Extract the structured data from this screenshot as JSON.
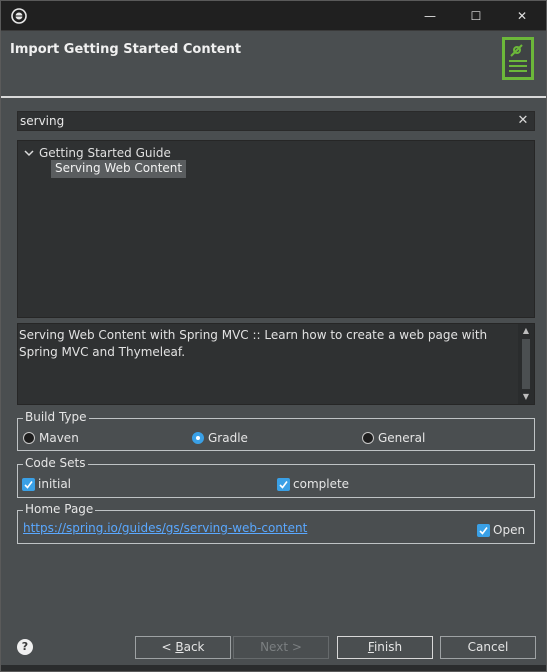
{
  "window": {
    "banner_title": "Import Getting Started Content",
    "minimize_glyph": "—",
    "maximize_glyph": "☐",
    "close_glyph": "✕"
  },
  "search": {
    "value": "serving",
    "clear_glyph": "✕"
  },
  "tree": {
    "group_label": "Getting Started Guide",
    "item_label": "Serving Web Content"
  },
  "description": {
    "text": "Serving Web Content with Spring MVC :: Learn how to create a web page with Spring MVC and Thymeleaf."
  },
  "build_type": {
    "legend": "Build Type",
    "options": [
      {
        "label": "Maven",
        "selected": false
      },
      {
        "label": "Gradle",
        "selected": true
      },
      {
        "label": "General",
        "selected": false
      }
    ]
  },
  "code_sets": {
    "legend": "Code Sets",
    "options": [
      {
        "label": "initial",
        "checked": true
      },
      {
        "label": "complete",
        "checked": true
      }
    ]
  },
  "home_page": {
    "legend": "Home Page",
    "url": "https://spring.io/guides/gs/serving-web-content",
    "open_label": "Open",
    "open_checked": true
  },
  "footer": {
    "help_glyph": "?",
    "back_pre": "< ",
    "back_u": "B",
    "back_post": "ack",
    "next_label": "Next >",
    "finish_u": "F",
    "finish_post": "inish",
    "cancel_label": "Cancel"
  },
  "colors": {
    "accent": "#3aa0e6",
    "spring_green": "#6cb83a",
    "link": "#5aa8ff"
  },
  "icons": [
    "eclipse-app-icon",
    "spring-banner-icon",
    "chevron-down-icon",
    "clear-icon",
    "help-icon"
  ]
}
